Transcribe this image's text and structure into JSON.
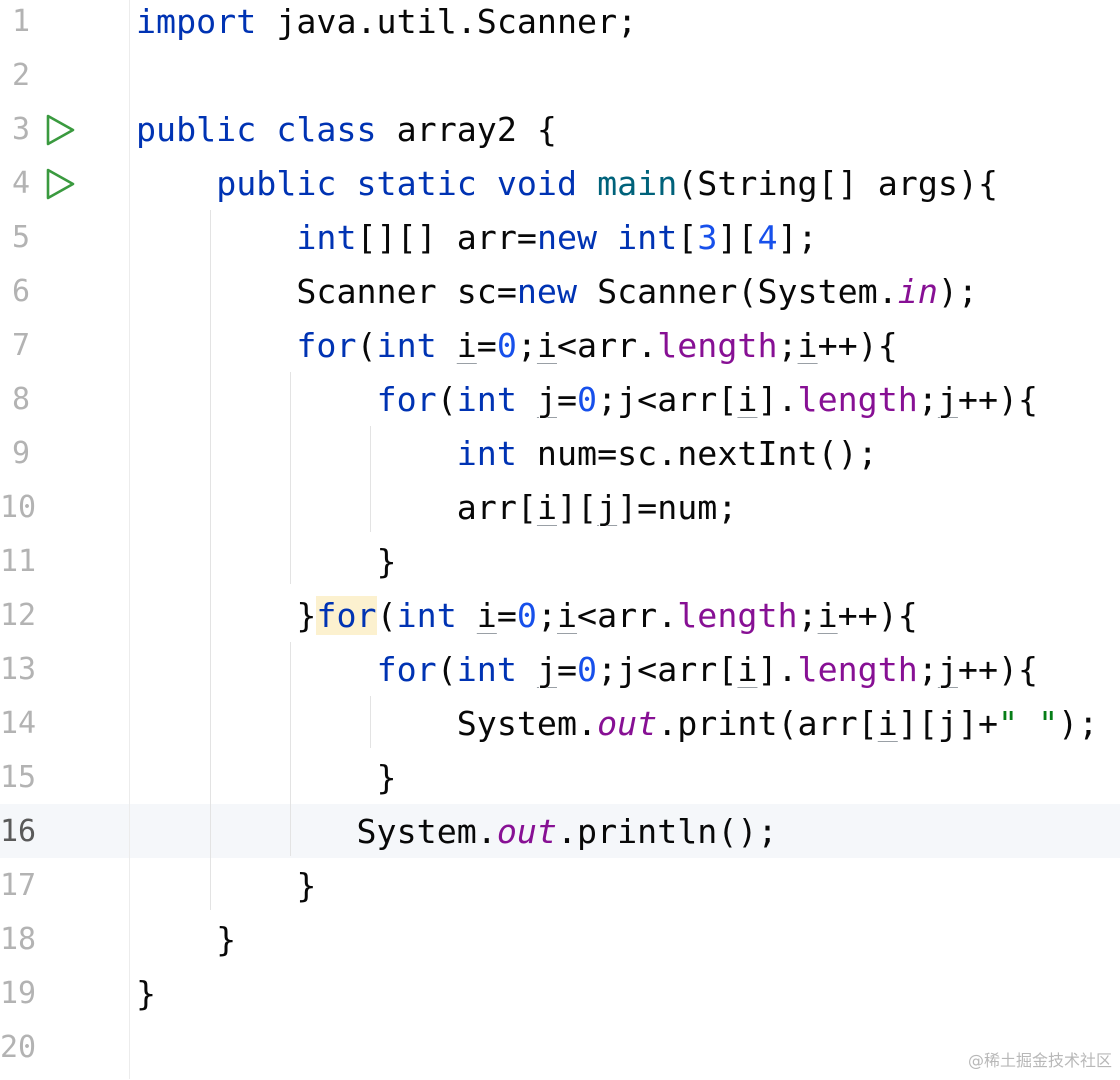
{
  "editor": {
    "language": "java",
    "line_numbers": [
      "1",
      "2",
      "3",
      "4",
      "5",
      "6",
      "7",
      "8",
      "9",
      "10",
      "11",
      "12",
      "13",
      "14",
      "15",
      "16",
      "17",
      "18",
      "19",
      "20"
    ],
    "run_gutter_lines": [
      3,
      4
    ],
    "current_line": 16,
    "lines": [
      [
        {
          "t": "import",
          "c": "kw"
        },
        {
          "t": " java.util.Scanner;"
        }
      ],
      [],
      [
        {
          "t": "public",
          "c": "kw"
        },
        {
          "t": " "
        },
        {
          "t": "class",
          "c": "kw"
        },
        {
          "t": " array2 {"
        }
      ],
      [
        {
          "t": "    "
        },
        {
          "t": "public",
          "c": "kw"
        },
        {
          "t": " "
        },
        {
          "t": "static",
          "c": "kw"
        },
        {
          "t": " "
        },
        {
          "t": "void",
          "c": "kw"
        },
        {
          "t": " "
        },
        {
          "t": "main",
          "c": "fn"
        },
        {
          "t": "(String[] args){"
        }
      ],
      [
        {
          "t": "        "
        },
        {
          "t": "int",
          "c": "kw"
        },
        {
          "t": "[][] arr="
        },
        {
          "t": "new",
          "c": "kw"
        },
        {
          "t": " "
        },
        {
          "t": "int",
          "c": "kw"
        },
        {
          "t": "["
        },
        {
          "t": "3",
          "c": "num"
        },
        {
          "t": "]["
        },
        {
          "t": "4",
          "c": "num"
        },
        {
          "t": "];"
        }
      ],
      [
        {
          "t": "        Scanner sc="
        },
        {
          "t": "new",
          "c": "kw"
        },
        {
          "t": " Scanner(System."
        },
        {
          "t": "in",
          "c": "sfld"
        },
        {
          "t": ");"
        }
      ],
      [
        {
          "t": "        "
        },
        {
          "t": "for",
          "c": "kw"
        },
        {
          "t": "("
        },
        {
          "t": "int",
          "c": "kw"
        },
        {
          "t": " "
        },
        {
          "t": "i",
          "c": "var"
        },
        {
          "t": "="
        },
        {
          "t": "0",
          "c": "num"
        },
        {
          "t": ";"
        },
        {
          "t": "i",
          "c": "var"
        },
        {
          "t": "<arr."
        },
        {
          "t": "length",
          "c": "fld"
        },
        {
          "t": ";"
        },
        {
          "t": "i",
          "c": "var"
        },
        {
          "t": "++){"
        }
      ],
      [
        {
          "t": "            "
        },
        {
          "t": "for",
          "c": "kw"
        },
        {
          "t": "("
        },
        {
          "t": "int",
          "c": "kw"
        },
        {
          "t": " "
        },
        {
          "t": "j",
          "c": "var"
        },
        {
          "t": "="
        },
        {
          "t": "0",
          "c": "num"
        },
        {
          "t": ";"
        },
        {
          "t": "j"
        },
        {
          "t": "<arr["
        },
        {
          "t": "i",
          "c": "var"
        },
        {
          "t": "]."
        },
        {
          "t": "length",
          "c": "fld"
        },
        {
          "t": ";"
        },
        {
          "t": "j",
          "c": "var"
        },
        {
          "t": "++){"
        }
      ],
      [
        {
          "t": "                "
        },
        {
          "t": "int",
          "c": "kw"
        },
        {
          "t": " num=sc.nextInt();"
        }
      ],
      [
        {
          "t": "                arr["
        },
        {
          "t": "i",
          "c": "var"
        },
        {
          "t": "]["
        },
        {
          "t": "j",
          "c": "var"
        },
        {
          "t": "]=num;"
        }
      ],
      [
        {
          "t": "            }"
        }
      ],
      [
        {
          "t": "        }"
        },
        {
          "t": "for",
          "c": "kw hl"
        },
        {
          "t": "("
        },
        {
          "t": "int",
          "c": "kw"
        },
        {
          "t": " "
        },
        {
          "t": "i",
          "c": "var"
        },
        {
          "t": "="
        },
        {
          "t": "0",
          "c": "num"
        },
        {
          "t": ";"
        },
        {
          "t": "i",
          "c": "var"
        },
        {
          "t": "<arr."
        },
        {
          "t": "length",
          "c": "fld"
        },
        {
          "t": ";"
        },
        {
          "t": "i",
          "c": "var"
        },
        {
          "t": "++){"
        }
      ],
      [
        {
          "t": "            "
        },
        {
          "t": "for",
          "c": "kw"
        },
        {
          "t": "("
        },
        {
          "t": "int",
          "c": "kw"
        },
        {
          "t": " "
        },
        {
          "t": "j",
          "c": "var"
        },
        {
          "t": "="
        },
        {
          "t": "0",
          "c": "num"
        },
        {
          "t": ";"
        },
        {
          "t": "j"
        },
        {
          "t": "<arr["
        },
        {
          "t": "i",
          "c": "var"
        },
        {
          "t": "]."
        },
        {
          "t": "length",
          "c": "fld"
        },
        {
          "t": ";"
        },
        {
          "t": "j",
          "c": "var"
        },
        {
          "t": "++){"
        }
      ],
      [
        {
          "t": "                System."
        },
        {
          "t": "out",
          "c": "sfld"
        },
        {
          "t": ".print(arr["
        },
        {
          "t": "i",
          "c": "var"
        },
        {
          "t": "][j]+"
        },
        {
          "t": "\" \"",
          "c": "str"
        },
        {
          "t": ");"
        }
      ],
      [
        {
          "t": "            }"
        }
      ],
      [
        {
          "t": "           System."
        },
        {
          "t": "out",
          "c": "sfld"
        },
        {
          "t": ".println();"
        }
      ],
      [
        {
          "t": "        }"
        }
      ],
      [
        {
          "t": "    }"
        }
      ],
      [
        {
          "t": "}"
        }
      ],
      []
    ]
  },
  "colors": {
    "keyword": "#0033b3",
    "number": "#1750eb",
    "field": "#871094",
    "line_number": "#b3b3b3",
    "run_icon": "#3a9a3f",
    "current_line_bg": "#f5f7fa"
  },
  "icons": {
    "run": "run-triangle-icon"
  },
  "watermark": "@稀土掘金技术社区"
}
